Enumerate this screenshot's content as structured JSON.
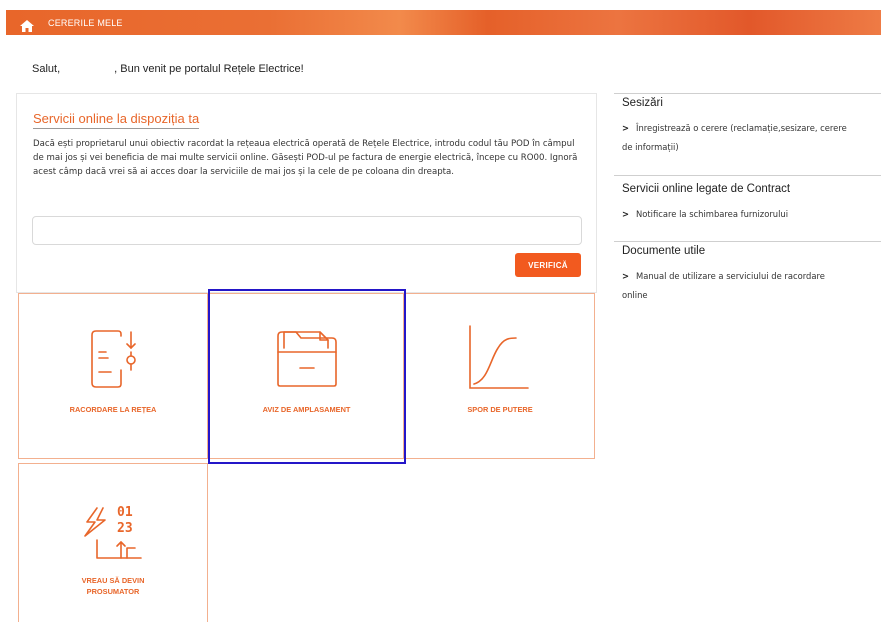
{
  "header": {
    "breadcrumb": "CERERILE MELE",
    "brand_color": "#e8662a"
  },
  "greeting": {
    "prefix": "Salut,",
    "suffix": ", Bun venit pe portalul Rețele Electrice!"
  },
  "services_card": {
    "title": "Servicii online la dispoziția ta",
    "description": "Dacă ești proprietarul unui obiectiv racordat la rețeaua electrică operată de Rețele Electrice, introdu codul tău POD în câmpul de mai jos și vei beneficia de mai multe servicii online. Găsești POD-ul pe factura de energie electrică, începe cu RO00. Ignoră acest câmp dacă vrei să ai acces doar la serviciile de mai jos și la cele de pe coloana din dreapta.",
    "pod_input_value": "",
    "verify_label": "VERIFICĂ"
  },
  "tiles": [
    {
      "label": "RACORDARE LA REȚEA",
      "icon": "plug-request-icon"
    },
    {
      "label": "AVIZ DE AMPLASAMENT",
      "icon": "folder-icon"
    },
    {
      "label": "SPOR DE PUTERE",
      "icon": "growth-curve-icon"
    },
    {
      "label_line1": "VREAU SĂ DEVIN",
      "label_line2": "PROSUMATOR",
      "icon": "energy-meter-icon"
    }
  ],
  "sidebar": {
    "sections": [
      {
        "title": "Sesizări",
        "links": [
          {
            "line1": "Înregistrează o cerere (reclamație,sesizare, cerere",
            "line2": "de informații)"
          }
        ]
      },
      {
        "title": "Servicii online legate de Contract",
        "links": [
          {
            "line1": "Notificare la schimbarea furnizorului"
          }
        ]
      },
      {
        "title": "Documente utile",
        "links": [
          {
            "line1": "Manual de utilizare a serviciului de racordare",
            "line2": "online"
          }
        ]
      }
    ]
  }
}
